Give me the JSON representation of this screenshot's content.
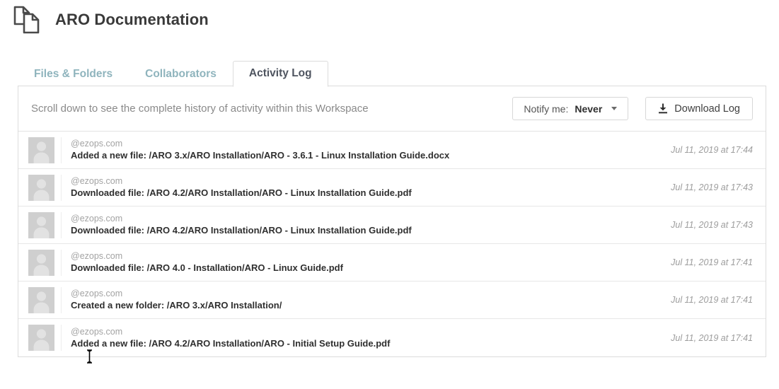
{
  "header": {
    "title": "ARO Documentation",
    "icon": "documents-icon"
  },
  "tabs": [
    {
      "label": "Files & Folders",
      "active": false,
      "name": "tab-files-folders"
    },
    {
      "label": "Collaborators",
      "active": false,
      "name": "tab-collaborators"
    },
    {
      "label": "Activity Log",
      "active": true,
      "name": "tab-activity-log"
    }
  ],
  "toolbar": {
    "description": "Scroll down to see the complete history of activity within this Workspace",
    "notify": {
      "label": "Notify me:",
      "value": "Never",
      "caret_icon": "chevron-down-icon"
    },
    "download": {
      "label": "Download Log",
      "icon": "download-icon"
    }
  },
  "activity": [
    {
      "user": "@ezops.com",
      "action": "Added a new file: /ARO 3.x/ARO Installation/ARO - 3.6.1 - Linux Installation Guide.docx",
      "time": "Jul 11, 2019 at 17:44"
    },
    {
      "user": "@ezops.com",
      "action": "Downloaded file: /ARO 4.2/ARO Installation/ARO - Linux Installation Guide.pdf",
      "time": "Jul 11, 2019 at 17:43"
    },
    {
      "user": "@ezops.com",
      "action": "Downloaded file: /ARO 4.2/ARO Installation/ARO - Linux Installation Guide.pdf",
      "time": "Jul 11, 2019 at 17:43"
    },
    {
      "user": "@ezops.com",
      "action": "Downloaded file: /ARO 4.0 - Installation/ARO - Linux Guide.pdf",
      "time": "Jul 11, 2019 at 17:41"
    },
    {
      "user": "@ezops.com",
      "action": "Created a new folder: /ARO 3.x/ARO Installation/",
      "time": "Jul 11, 2019 at 17:41"
    },
    {
      "user": "@ezops.com",
      "action": "Added a new file: /ARO 4.2/ARO Installation/ARO - Initial Setup Guide.pdf",
      "time": "Jul 11, 2019 at 17:41"
    }
  ],
  "colors": {
    "tab_inactive": "#8fb4bd",
    "tab_active": "#4e545f",
    "border": "#dcdcdc",
    "muted_text": "#8a8a8a",
    "avatar_bg": "#cfcfcf"
  },
  "cursor": {
    "type": "text-cursor-i-beam"
  }
}
